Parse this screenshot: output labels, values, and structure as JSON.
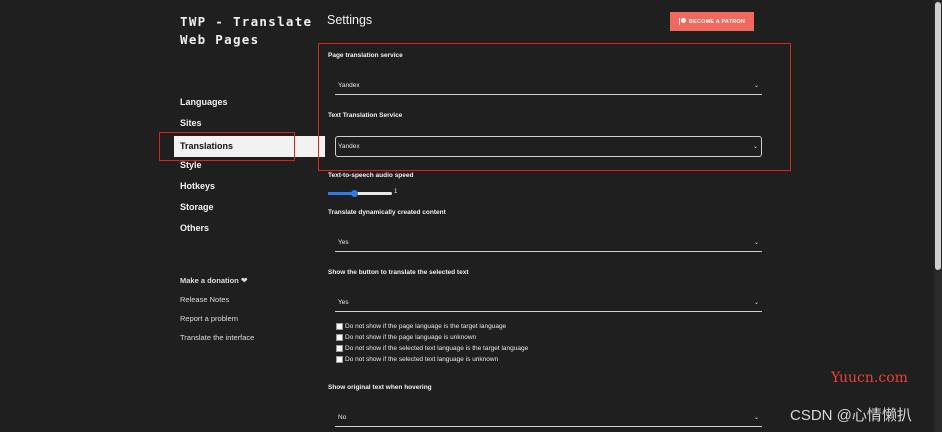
{
  "app": {
    "title": "TWP - Translate Web Pages"
  },
  "sidebar": {
    "items": [
      {
        "label": "Languages"
      },
      {
        "label": "Sites"
      },
      {
        "label": "Translations"
      },
      {
        "label": "Style"
      },
      {
        "label": "Hotkeys"
      },
      {
        "label": "Storage"
      },
      {
        "label": "Others"
      }
    ],
    "active": "Translations",
    "links": [
      {
        "label": "Make a donation"
      },
      {
        "label": "Release Notes"
      },
      {
        "label": "Report a problem"
      },
      {
        "label": "Translate the interface"
      }
    ]
  },
  "header": {
    "title": "Settings",
    "patron_button": "BECOME A PATRON"
  },
  "settings": {
    "page_translation": {
      "label": "Page translation service",
      "value": "Yandex"
    },
    "text_translation": {
      "label": "Text Translation Service",
      "value": "Yandex"
    },
    "tts_speed": {
      "label": "Text-to-speech audio speed",
      "value": "1",
      "fraction": 0.4
    },
    "dynamic": {
      "label": "Translate dynamically created content",
      "value": "Yes"
    },
    "show_button": {
      "label": "Show the button to translate the selected text",
      "value": "Yes"
    },
    "checkboxes": [
      {
        "label": "Do not show if the page language is the target language",
        "checked": false
      },
      {
        "label": "Do not show if the page language is unknown",
        "checked": false
      },
      {
        "label": "Do not show if the selected text language is the target language",
        "checked": false
      },
      {
        "label": "Do not show if the selected text language is unknown",
        "checked": false
      }
    ],
    "hover": {
      "label": "Show original text when hovering",
      "value": "No"
    }
  },
  "watermarks": {
    "site": "Yuucn.com",
    "csdn": "CSDN @心情懒扒"
  },
  "colors": {
    "accent": "#2f7de1",
    "patron": "#f1685e",
    "highlight": "#e02020",
    "background": "#1f1f1f"
  },
  "icons": {
    "heart": "heart-icon",
    "chevron": "chevron-down-icon",
    "patreon": "patreon-icon"
  }
}
